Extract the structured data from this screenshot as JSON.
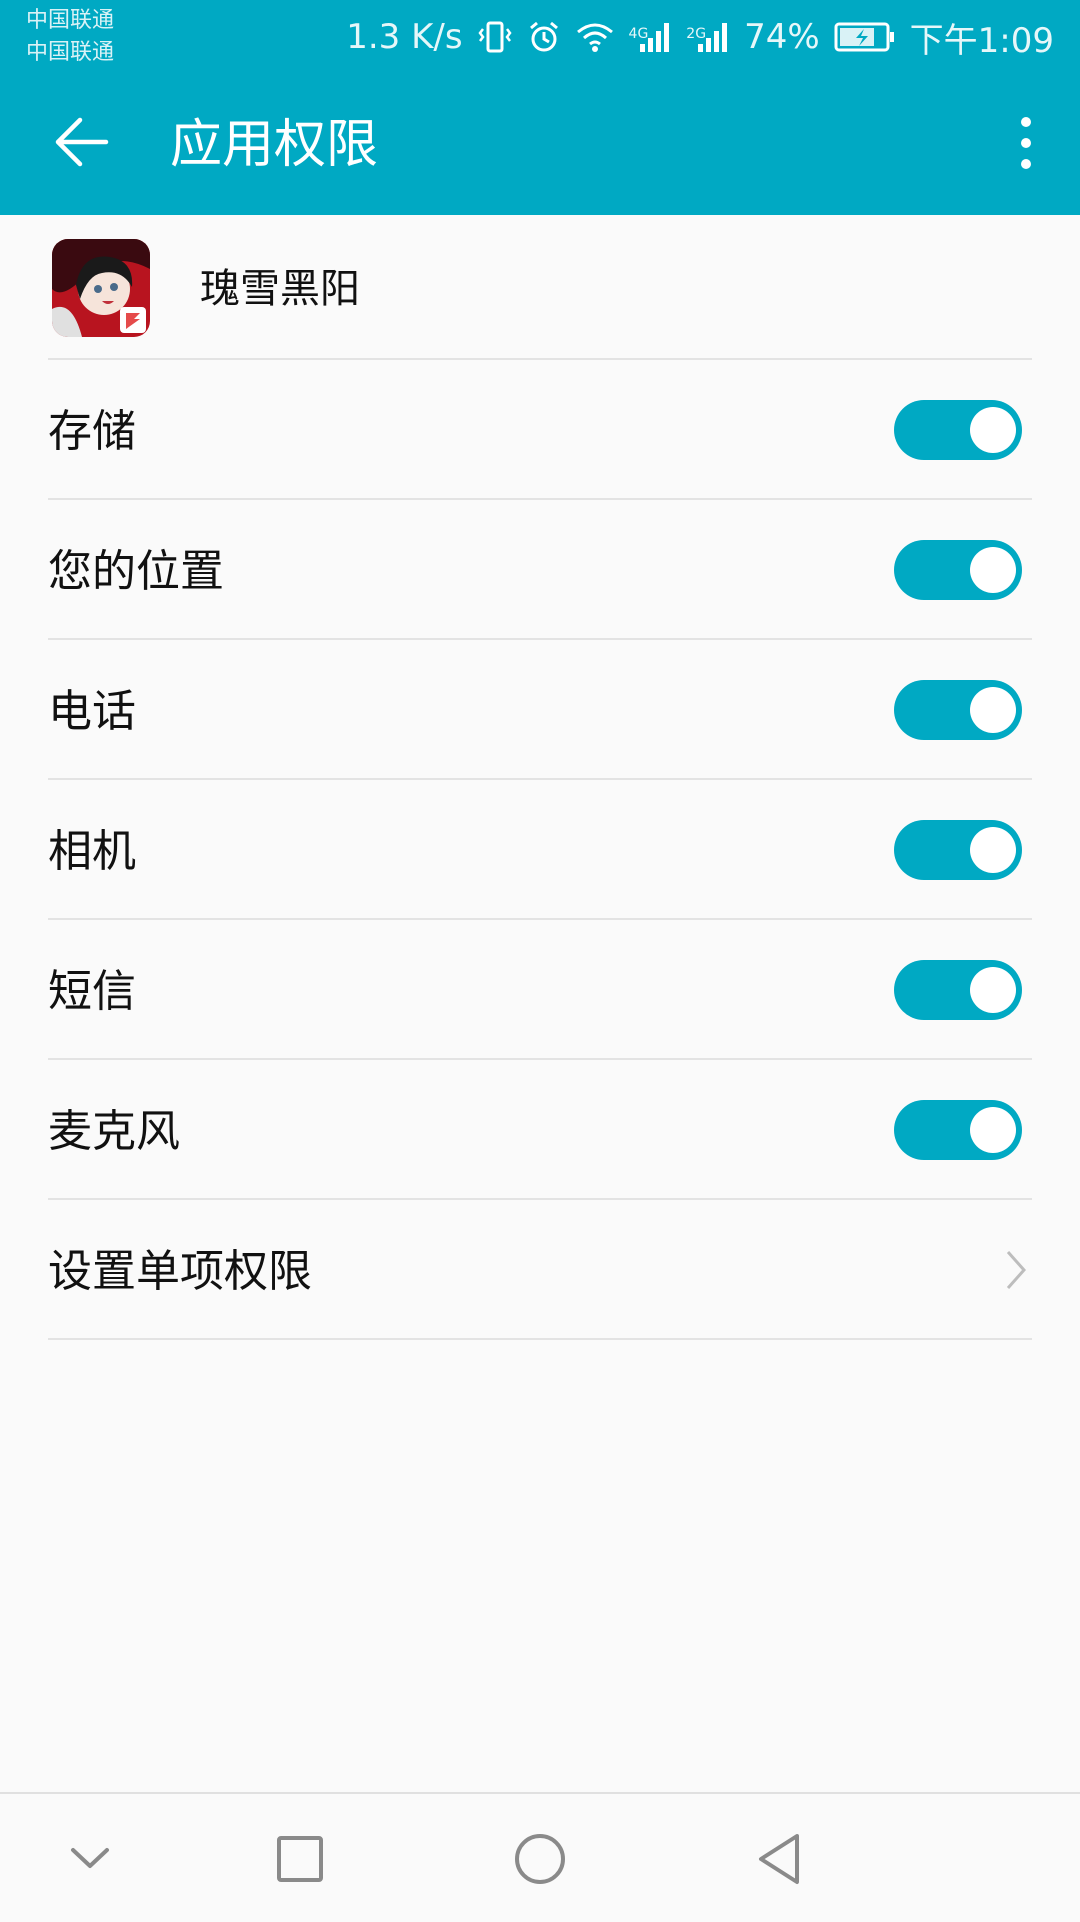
{
  "status_bar": {
    "carrier_1": "中国联通",
    "carrier_2": "中国联通",
    "speed": "1.3 K/s",
    "net_1": "4G",
    "net_2": "2G",
    "battery": "74%",
    "time": "下午1:09"
  },
  "app_bar": {
    "title": "应用权限",
    "back_icon": "arrow-left",
    "menu_icon": "more-vertical"
  },
  "app": {
    "name": "瑰雪黑阳",
    "icon": "app-icon"
  },
  "permissions": [
    {
      "label": "存储",
      "enabled": true
    },
    {
      "label": "您的位置",
      "enabled": true
    },
    {
      "label": "电话",
      "enabled": true
    },
    {
      "label": "相机",
      "enabled": true
    },
    {
      "label": "短信",
      "enabled": true
    },
    {
      "label": "麦克风",
      "enabled": true
    }
  ],
  "individual_permissions": {
    "label": "设置单项权限",
    "icon": "chevron-right"
  },
  "nav_bar": {
    "buttons": [
      "chevron-down",
      "square-recents",
      "circle-home",
      "triangle-back"
    ]
  },
  "colors": {
    "accent": "#00a9c3",
    "background": "#fafafa",
    "divider": "#e3e3e3"
  }
}
